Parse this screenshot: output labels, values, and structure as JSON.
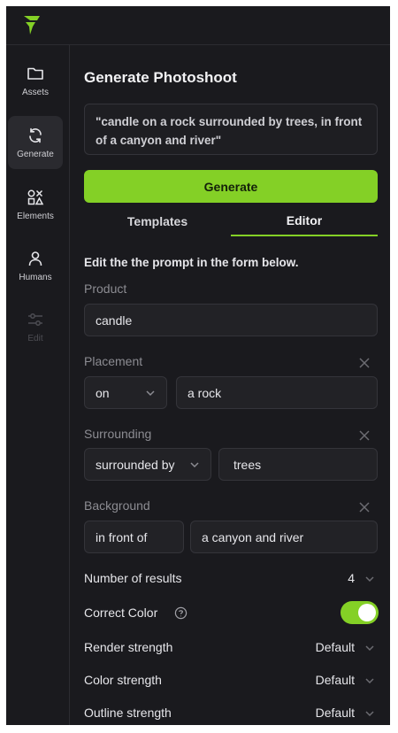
{
  "nav": {
    "items": [
      {
        "label": "Assets",
        "icon": "folder-icon"
      },
      {
        "label": "Generate",
        "icon": "refresh-icon"
      },
      {
        "label": "Elements",
        "icon": "shapes-icon"
      },
      {
        "label": "Humans",
        "icon": "user-icon"
      },
      {
        "label": "Edit",
        "icon": "sliders-icon"
      }
    ]
  },
  "page": {
    "title": "Generate Photoshoot"
  },
  "prompt": {
    "text": "\"candle on a rock surrounded by trees, in front of a canyon and river\""
  },
  "actions": {
    "generate_label": "Generate"
  },
  "tabs": [
    {
      "label": "Templates"
    },
    {
      "label": "Editor"
    }
  ],
  "editor": {
    "intro": "Edit the the prompt in the form below.",
    "product": {
      "label": "Product",
      "value": "candle"
    },
    "placement": {
      "label": "Placement",
      "relation": "on",
      "value": "a rock"
    },
    "surrounding": {
      "label": "Surrounding",
      "relation": "surrounded by",
      "value": "trees"
    },
    "background": {
      "label": "Background",
      "relation": "in front of",
      "value": "a canyon and river"
    }
  },
  "settings": {
    "results": {
      "label": "Number of results",
      "value": "4"
    },
    "correct_color": {
      "label": "Correct Color",
      "on": true
    },
    "render_strength": {
      "label": "Render strength",
      "value": "Default"
    },
    "color_strength": {
      "label": "Color strength",
      "value": "Default"
    },
    "outline_strength": {
      "label": "Outline strength",
      "value": "Default"
    }
  },
  "colors": {
    "accent": "#84d026",
    "background": "#1a1a1e",
    "field": "#222226"
  }
}
